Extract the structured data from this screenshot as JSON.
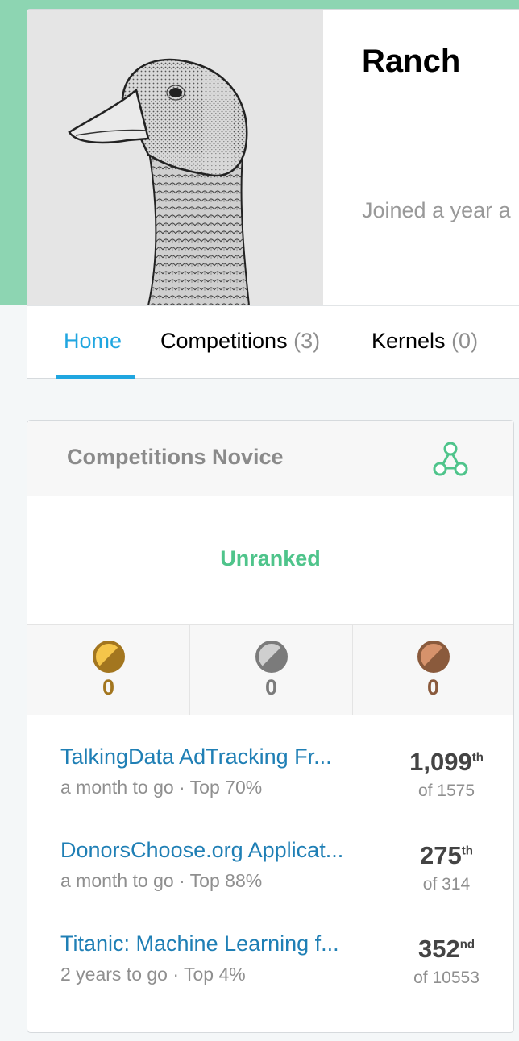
{
  "profile": {
    "name": "Ranch",
    "joined": "Joined a year a"
  },
  "tabs": [
    {
      "label": "Home",
      "count": ""
    },
    {
      "label": "Competitions",
      "count": "(3)"
    },
    {
      "label": "Kernels",
      "count": "(0)"
    }
  ],
  "competitions_card": {
    "title": "Competitions Novice",
    "tier_icon": "novice-tier-icon",
    "rank_status": "Unranked",
    "medals": [
      {
        "type": "gold",
        "count": "0",
        "color": "#a3761f"
      },
      {
        "type": "silver",
        "count": "0",
        "color": "#7b7b7b"
      },
      {
        "type": "bronze",
        "count": "0",
        "color": "#8a5a3c"
      }
    ],
    "entries": [
      {
        "name": "TalkingData AdTracking Fr...",
        "meta": "a month to go · Top 70%",
        "rank": "1,099",
        "suffix": "th",
        "of": "of 1575"
      },
      {
        "name": "DonorsChoose.org Applicat...",
        "meta": "a month to go · Top 88%",
        "rank": "275",
        "suffix": "th",
        "of": "of 314"
      },
      {
        "name": "Titanic: Machine Learning f...",
        "meta": "2 years to go · Top 4%",
        "rank": "352",
        "suffix": "nd",
        "of": "of 10553"
      }
    ]
  },
  "colors": {
    "accent": "#20a6e0",
    "header_band": "#8dd5b2",
    "rank_green": "#4fc48b",
    "link_blue": "#1f7fb5"
  }
}
